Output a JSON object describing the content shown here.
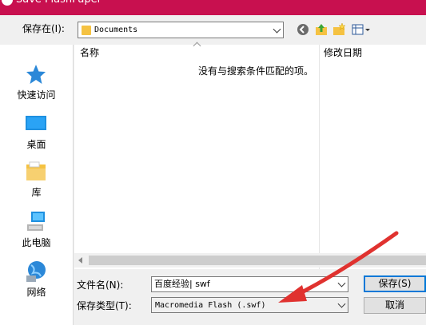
{
  "window": {
    "title": "Save FlashPaper"
  },
  "toolbar": {
    "save_in_label": "保存在(I):",
    "location_value": "Documents",
    "icons": [
      "back-icon",
      "up-folder-icon",
      "new-folder-icon",
      "view-menu-icon"
    ]
  },
  "sidebar": {
    "items": [
      {
        "label": "快速访问",
        "icon": "star-icon"
      },
      {
        "label": "桌面",
        "icon": "desktop-icon"
      },
      {
        "label": "库",
        "icon": "library-icon"
      },
      {
        "label": "此电脑",
        "icon": "computer-icon"
      },
      {
        "label": "网络",
        "icon": "network-icon"
      }
    ]
  },
  "filelist": {
    "columns": {
      "name": "名称",
      "modified": "修改日期"
    },
    "empty_message": "没有与搜索条件匹配的项。"
  },
  "form": {
    "filename_label": "文件名(N):",
    "filename_value": "百度经验| swf",
    "filetype_label": "保存类型(T):",
    "filetype_value": "Macromedia Flash (.swf)"
  },
  "buttons": {
    "save": "保存(S)",
    "cancel": "取消"
  },
  "colors": {
    "titlebar": "#c8104f",
    "folder": "#f5c242",
    "accent": "#0078d7",
    "annotation_arrow": "#e0322f"
  }
}
